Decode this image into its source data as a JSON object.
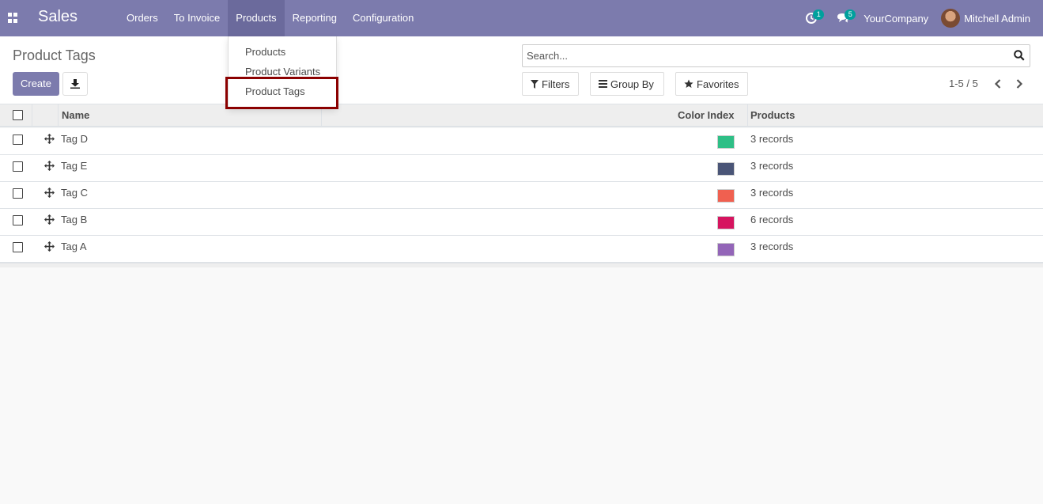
{
  "navbar": {
    "brand": "Sales",
    "menu": [
      "Orders",
      "To Invoice",
      "Products",
      "Reporting",
      "Configuration"
    ],
    "activity_count": "1",
    "message_count": "5",
    "company": "YourCompany",
    "user": "Mitchell Admin",
    "icons": [
      "apps-icon",
      "activity-clock-icon",
      "chat-bubble-icon",
      "avatar"
    ]
  },
  "products_dropdown": {
    "items": [
      "Products",
      "Product Variants",
      "Product Tags"
    ],
    "highlighted": "Product Tags"
  },
  "control_panel": {
    "title": "Product Tags",
    "create_label": "Create",
    "search_placeholder": "Search...",
    "filters_label": "Filters",
    "groupby_label": "Group By",
    "favorites_label": "Favorites",
    "pager": "1-5 / 5"
  },
  "table": {
    "headers": [
      "Name",
      "Color Index",
      "Products"
    ],
    "rows": [
      {
        "name": "Tag D",
        "color": "#2ebf86",
        "products": "3 records"
      },
      {
        "name": "Tag E",
        "color": "#4a5577",
        "products": "3 records"
      },
      {
        "name": "Tag C",
        "color": "#f06050",
        "products": "3 records"
      },
      {
        "name": "Tag B",
        "color": "#d6145f",
        "products": "6 records"
      },
      {
        "name": "Tag A",
        "color": "#9365b8",
        "products": "3 records"
      }
    ]
  },
  "colors": {
    "navbar": "#7c7bad",
    "highlight": "#8b0000",
    "badge": "#00a09d"
  }
}
